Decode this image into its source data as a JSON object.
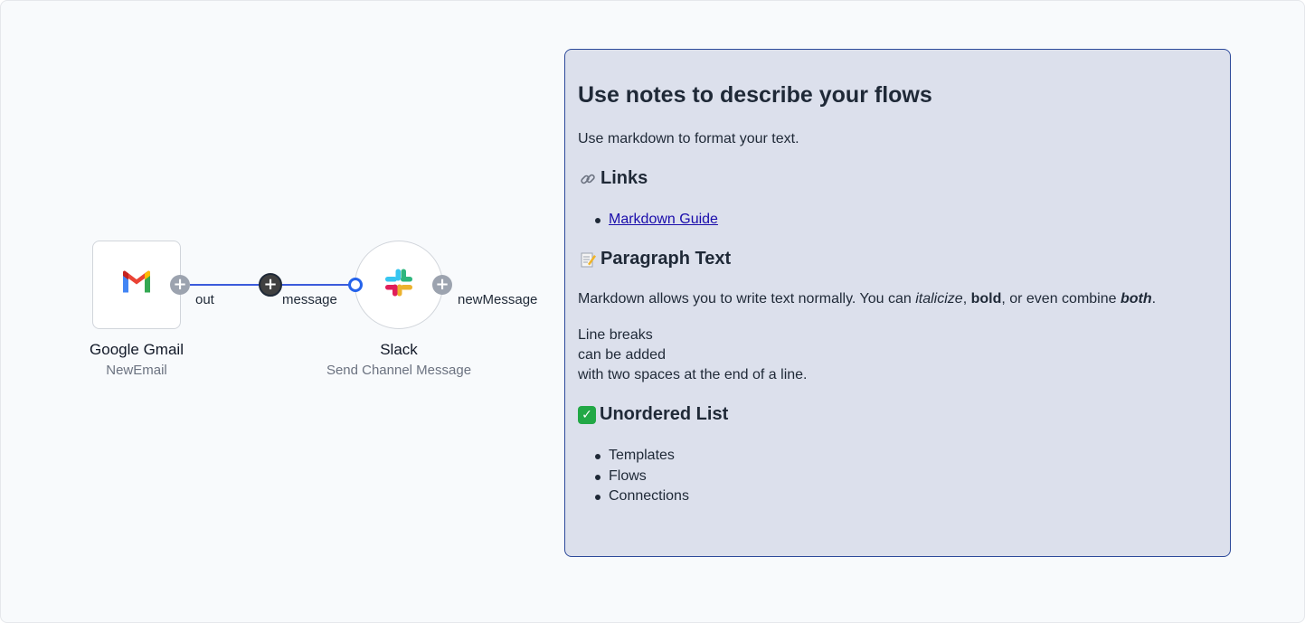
{
  "nodes": {
    "gmail": {
      "title": "Google Gmail",
      "subtitle": "NewEmail",
      "output_port": "out",
      "icon": "gmail-icon"
    },
    "slack": {
      "title": "Slack",
      "subtitle": "Send Channel Message",
      "input_port": "message",
      "output_port": "newMessage",
      "icon": "slack-icon"
    }
  },
  "colors": {
    "edge": "#3b5bdb",
    "note_bg": "#dce0ec",
    "note_border": "#2d4a9a",
    "link": "#1a0dab"
  },
  "note": {
    "title": "Use notes to describe your flows",
    "intro": "Use markdown to format your text.",
    "links_heading": "Links",
    "links": [
      "Markdown Guide"
    ],
    "paragraph_heading": "Paragraph Text",
    "paragraph": {
      "part1": "Markdown allows you to write text normally. You can ",
      "italic": "italicize",
      "part2": ", ",
      "bold": "bold",
      "part3": ", or even combine ",
      "bold_italic": "both",
      "part4": "."
    },
    "line_breaks": [
      "Line breaks",
      "can be added",
      "with two spaces at the end of a line."
    ],
    "list_heading": "Unordered List",
    "list_items": [
      "Templates",
      "Flows",
      "Connections"
    ]
  }
}
